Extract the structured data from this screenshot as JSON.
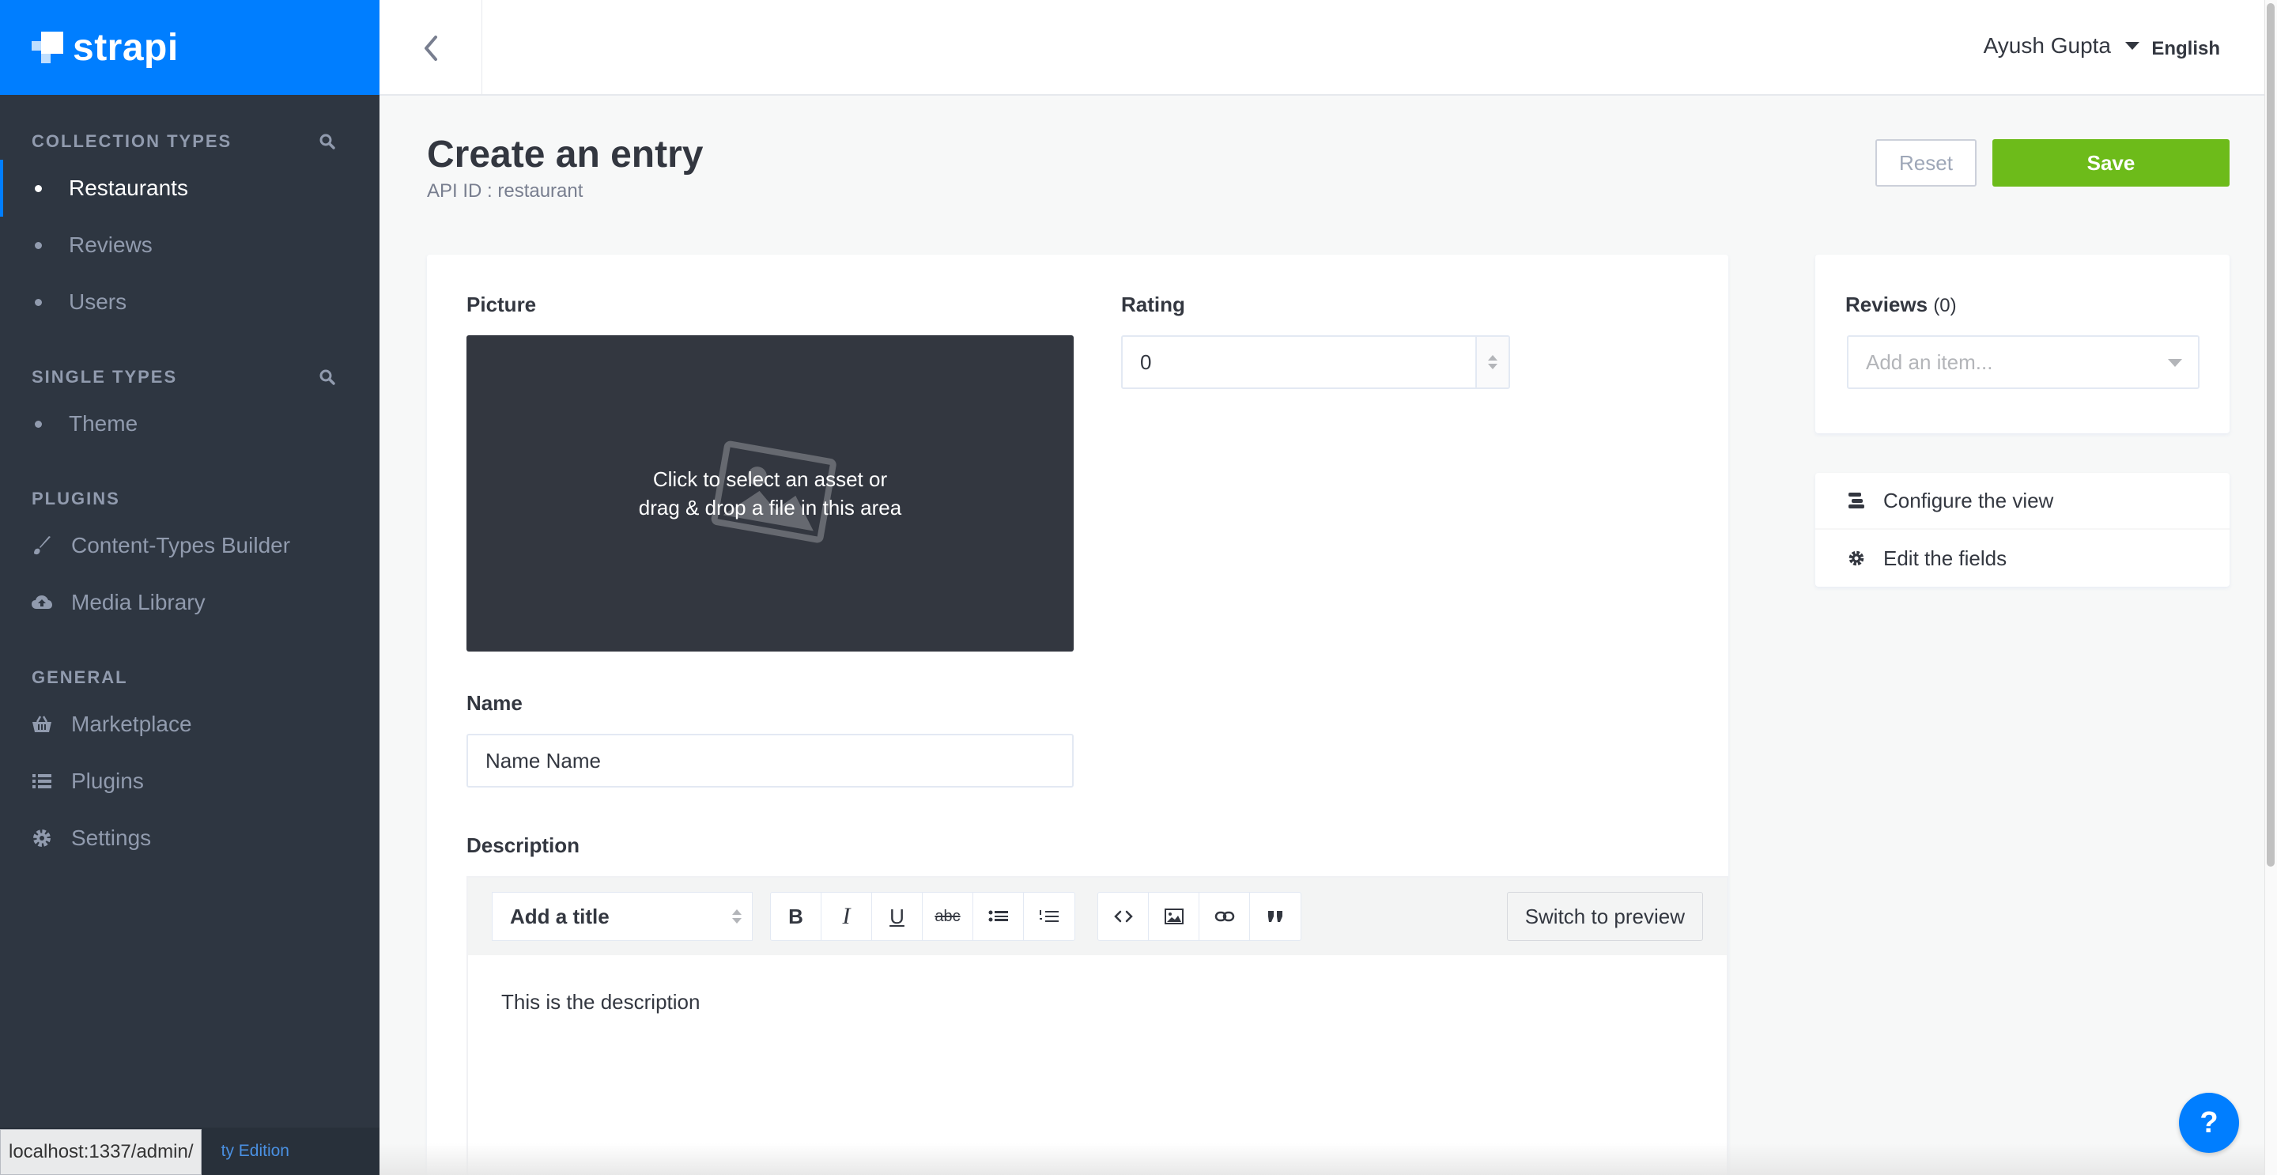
{
  "brand": {
    "name": "strapi"
  },
  "sidebar": {
    "sections": [
      {
        "title": "COLLECTION TYPES",
        "items": [
          "Restaurants",
          "Reviews",
          "Users"
        ]
      },
      {
        "title": "SINGLE TYPES",
        "items": [
          "Theme"
        ]
      },
      {
        "title": "PLUGINS",
        "items": [
          "Content-Types Builder",
          "Media Library"
        ]
      },
      {
        "title": "GENERAL",
        "items": [
          "Marketplace",
          "Plugins",
          "Settings"
        ]
      }
    ],
    "footer_text": "ty Edition",
    "url_hint": "localhost:1337/admin/"
  },
  "header": {
    "user_name": "Ayush Gupta",
    "language": "English"
  },
  "page": {
    "title": "Create an entry",
    "api_id": "API ID : restaurant"
  },
  "actions": {
    "reset_label": "Reset",
    "save_label": "Save"
  },
  "form": {
    "picture_label": "Picture",
    "dropzone_line1": "Click to select an asset or",
    "dropzone_line2": "drag & drop a file in this area",
    "rating_label": "Rating",
    "rating_value": "0",
    "name_label": "Name",
    "name_value": "Name Name",
    "description_label": "Description",
    "editor": {
      "title_select": "Add a title",
      "bold": "B",
      "italic": "I",
      "underline": "U",
      "strike": "abc",
      "preview_label": "Switch to preview",
      "content": "This is the description"
    }
  },
  "relations": {
    "reviews_label": "Reviews",
    "reviews_count": "(0)",
    "reviews_placeholder": "Add an item..."
  },
  "links": {
    "configure_view": "Configure the view",
    "edit_fields": "Edit the fields"
  },
  "help": {
    "label": "?"
  },
  "colors": {
    "brand": "#007eff",
    "sidebar": "#2e3641",
    "save": "#6dbb1a"
  }
}
